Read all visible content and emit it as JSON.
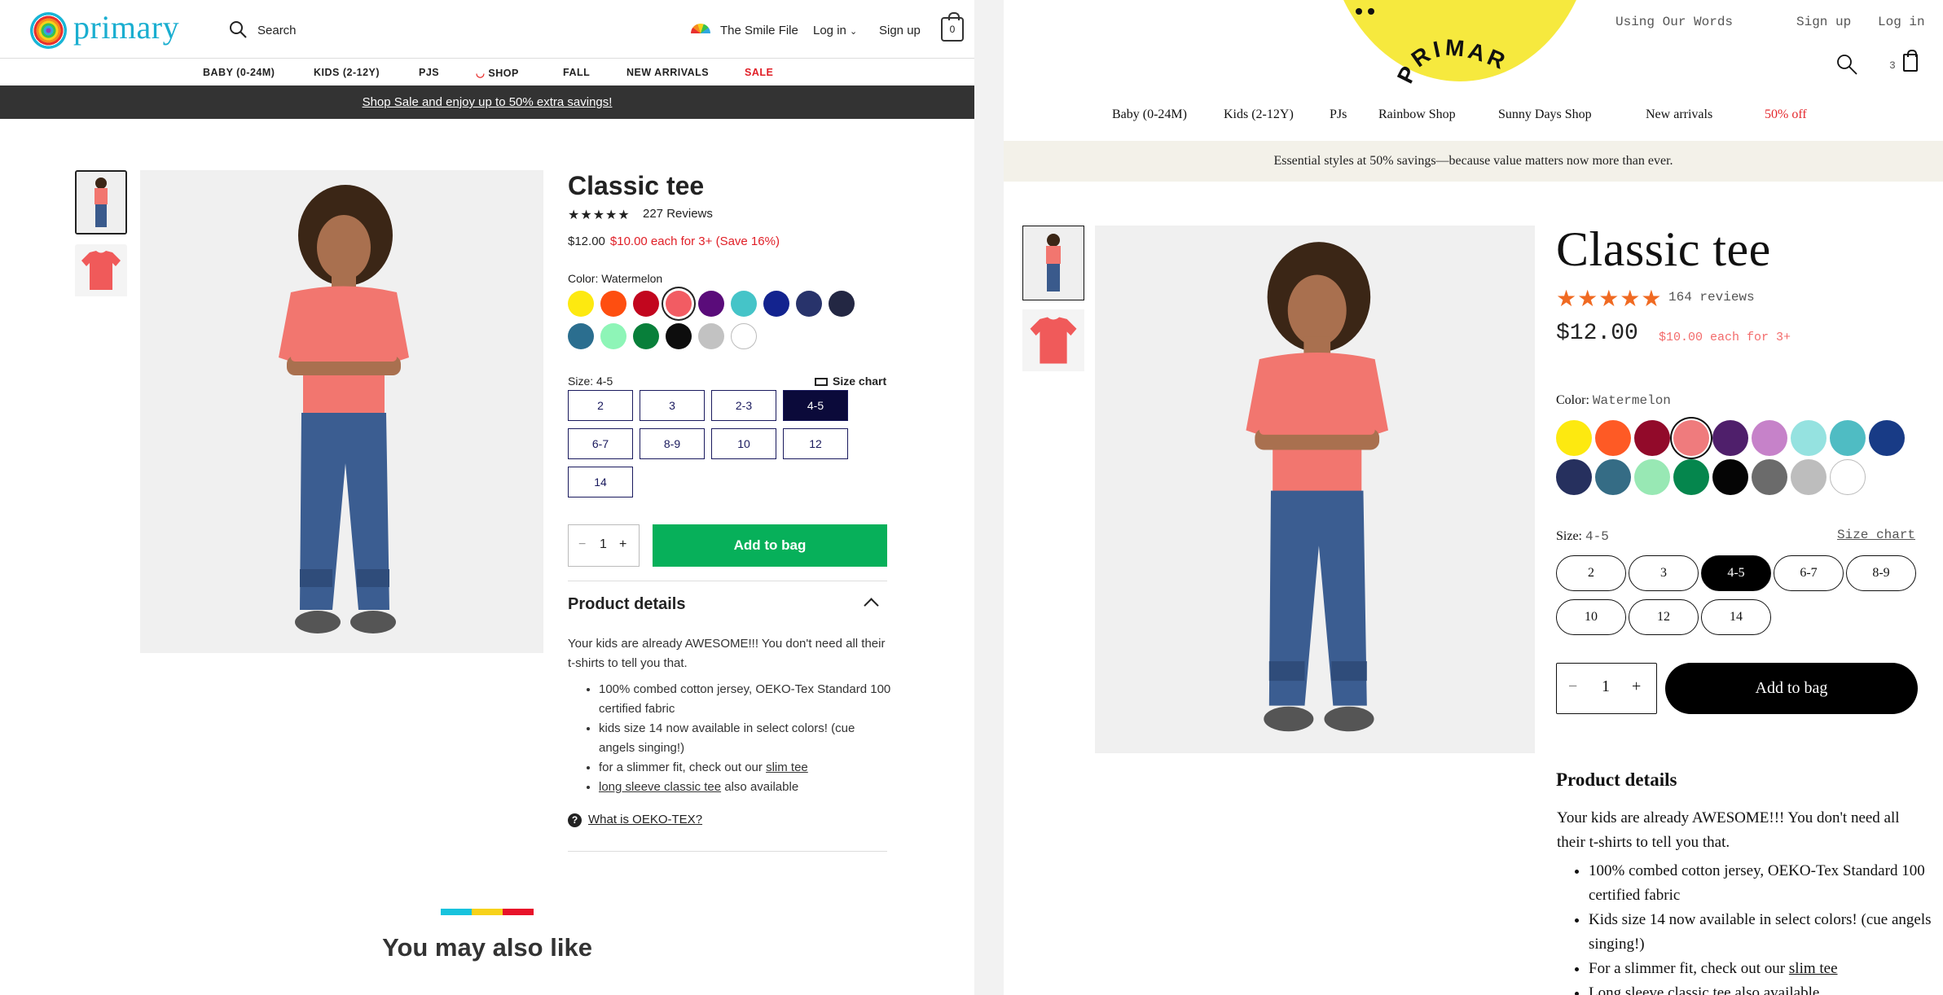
{
  "left": {
    "logo": "primary",
    "search_label": "Search",
    "header_links": [
      "The Smile File",
      "Log in",
      "Sign up"
    ],
    "bag_count": "0",
    "nav": [
      "BABY (0-24M)",
      "KIDS (2-12Y)",
      "PJS",
      "SHOP",
      "FALL",
      "NEW ARRIVALS",
      "SALE"
    ],
    "promo": "Shop Sale and enjoy up to 50% extra savings!",
    "product": {
      "title": "Classic tee",
      "stars": "★★★★★",
      "reviews": "227 Reviews",
      "price": "$12.00",
      "bulk_price": "$10.00 each for 3+ (Save 16%)",
      "color_label": "Color: Watermelon",
      "size_label": "Size: 4-5",
      "size_chart": "Size chart",
      "sizes": [
        "2",
        "3",
        "2-3",
        "4-5",
        "6-7",
        "8-9",
        "10",
        "12",
        "14"
      ],
      "selected_size": "4-5",
      "quantity": "1",
      "add_to_bag": "Add to bag",
      "details_heading": "Product details",
      "description": "Your kids are already AWESOME!!! You don't need all their t-shirts to tell you that.",
      "bullets": [
        "100% combed cotton jersey, OEKO-Tex Standard 100 certified fabric",
        "kids size 14 now available in select colors! (cue angels singing!)",
        "for a slimmer fit, check out our ",
        "slim tee",
        "long sleeve classic tee",
        " also available"
      ],
      "oeko_link": "What is OEKO-TEX?"
    },
    "swatches": [
      "#fde910",
      "#fe4e10",
      "#c2061e",
      "#f25c63",
      "#5a0c7a",
      "#45c4c8",
      "#13238f",
      "#28336b",
      "#232743",
      "#2b6e8f",
      "#8ef5b7",
      "#087f3a",
      "#0d0d0d",
      "#c2c2c2",
      "#ffffff"
    ],
    "you_may_also_like": "You may also like"
  },
  "right": {
    "brand": "PRIMARY",
    "top_links": [
      "Using Our Words",
      "Sign up",
      "Log in"
    ],
    "bag_count": "3",
    "nav": [
      "Baby (0-24M)",
      "Kids (2-12Y)",
      "PJs",
      "Rainbow Shop",
      "Sunny Days Shop",
      "New arrivals",
      "50% off"
    ],
    "promo": "Essential styles at 50% savings—because value matters now more than ever.",
    "product": {
      "title": "Classic tee",
      "stars": "★★★★★",
      "reviews": "164 reviews",
      "price": "$12.00",
      "bulk_price": "$10.00 each for 3+",
      "color_label": "Color:",
      "color_value": "Watermelon",
      "size_label": "Size:",
      "size_value": "4-5",
      "size_chart": "Size chart",
      "sizes": [
        "2",
        "3",
        "4-5",
        "6-7",
        "8-9",
        "10",
        "12",
        "14"
      ],
      "selected_size": "4-5",
      "quantity": "1",
      "add_to_bag": "Add to bag",
      "details_heading": "Product details",
      "description": "Your kids are already AWESOME!!! You don't need all their t-shirts to tell you that.",
      "bullets": [
        "100% combed cotton jersey, OEKO-Tex Standard 100 certified fabric",
        "Kids size 14 now available in select colors! (cue angels singing!)",
        "For a slimmer fit, check out our ",
        "slim tee",
        "Long sleeve classic tee also available"
      ]
    },
    "swatches": [
      "#fde910",
      "#fe5a25",
      "#920a2a",
      "#ef7b7d",
      "#4f1f6b",
      "#c682c9",
      "#95e2e0",
      "#4fbcc3",
      "#183b86",
      "#26305e",
      "#356c85",
      "#98e8b4",
      "#05864d",
      "#050505",
      "#6b6b6b",
      "#bdbdbd",
      "#ffffff"
    ]
  }
}
